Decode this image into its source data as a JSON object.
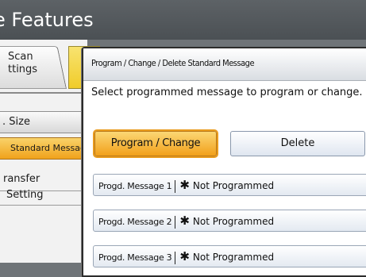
{
  "window": {
    "title": "e Features"
  },
  "tabs": [
    {
      "label": "Scan\nttings"
    }
  ],
  "sidebar": {
    "items": [
      {
        "label": ". Size"
      },
      {
        "label": "Standard Message"
      },
      {
        "label": "ransfer"
      },
      {
        "label": "Setting"
      }
    ]
  },
  "dialog": {
    "title": "Program / Change / Delete Standard Message",
    "instruction": "Select programmed message to program or change.",
    "program_change_label": "Program / Change",
    "delete_label": "Delete",
    "messages": [
      {
        "name": "Progd. Message 1",
        "star": "✱",
        "status": "Not Programmed"
      },
      {
        "name": "Progd. Message 2",
        "star": "✱",
        "status": "Not Programmed"
      },
      {
        "name": "Progd. Message 3",
        "star": "✱",
        "status": "Not Programmed"
      }
    ]
  },
  "colors": {
    "accent_orange": "#f2a01a",
    "title_bar": "#4b5054"
  }
}
